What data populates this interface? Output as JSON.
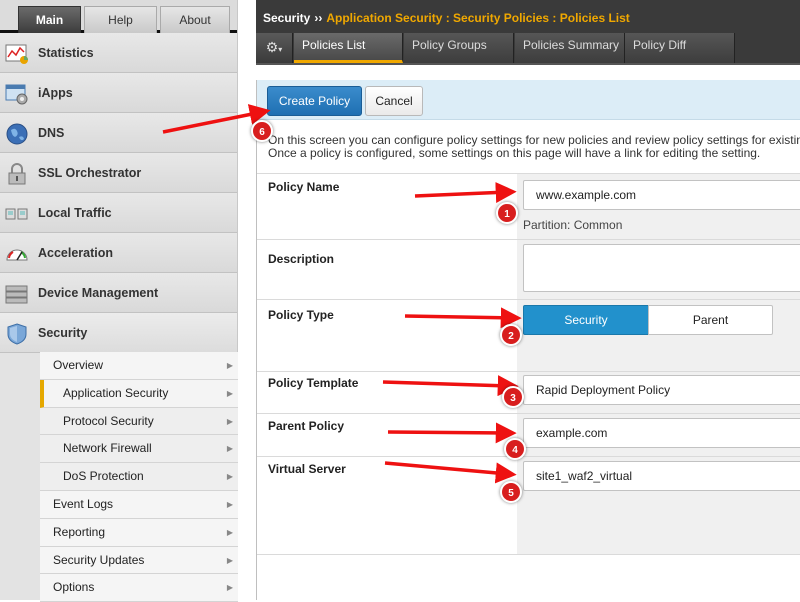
{
  "primary_tabs": {
    "main": "Main",
    "help": "Help",
    "about": "About"
  },
  "nav": {
    "items": [
      {
        "label": "Statistics",
        "icon": "statistics-icon"
      },
      {
        "label": "iApps",
        "icon": "iapps-icon"
      },
      {
        "label": "DNS",
        "icon": "dns-globe-icon"
      },
      {
        "label": "SSL Orchestrator",
        "icon": "ssl-lock-icon"
      },
      {
        "label": "Local Traffic",
        "icon": "local-traffic-icon"
      },
      {
        "label": "Acceleration",
        "icon": "gauge-icon"
      },
      {
        "label": "Device Management",
        "icon": "server-icon"
      },
      {
        "label": "Security",
        "icon": "shield-icon"
      }
    ],
    "security_submenu": [
      "Overview",
      "Application Security",
      "Protocol Security",
      "Network Firewall",
      "DoS Protection",
      "Event Logs",
      "Reporting",
      "Security Updates",
      "Options"
    ]
  },
  "breadcrumb": {
    "root": "Security",
    "separator": "››",
    "path": "Application Security : Security Policies : Policies List"
  },
  "subtabs": [
    "Policies List",
    "Policy Groups",
    "Policies Summary",
    "Policy Diff"
  ],
  "toolbar": {
    "create_label": "Create Policy",
    "cancel_label": "Cancel"
  },
  "description_text": {
    "line1": "On this screen you can configure policy settings for new policies and review policy settings for existing",
    "line2": "Once a policy is configured, some settings on this page will have a link for editing the setting."
  },
  "form": {
    "policy_name": {
      "label": "Policy Name",
      "value": "www.example.com",
      "partition": "Partition: Common"
    },
    "description": {
      "label": "Description",
      "value": ""
    },
    "policy_type": {
      "label": "Policy Type",
      "options": [
        "Security",
        "Parent"
      ],
      "selected": "Security"
    },
    "policy_template": {
      "label": "Policy Template",
      "value": "Rapid Deployment Policy"
    },
    "parent_policy": {
      "label": "Parent Policy",
      "value": "example.com"
    },
    "virtual_server": {
      "label": "Virtual Server",
      "value": "site1_waf2_virtual"
    }
  },
  "annotations": [
    "1",
    "2",
    "3",
    "4",
    "5",
    "6"
  ],
  "colors": {
    "accent_orange": "#f0a800",
    "primary_blue": "#2291cc",
    "annotation_red": "#d81e1e",
    "topbar_dark": "#3a3a3a"
  }
}
